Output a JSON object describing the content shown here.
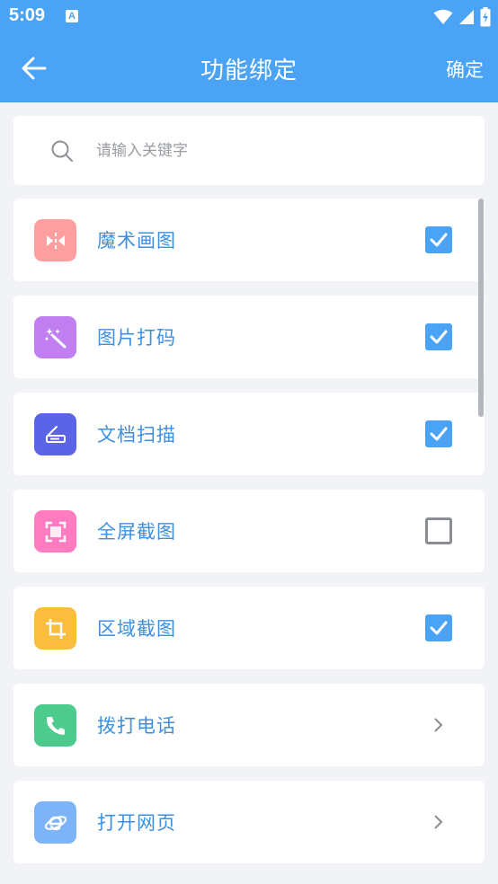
{
  "status_bar": {
    "time": "5:09",
    "notification_badge": "A"
  },
  "app_bar": {
    "title": "功能绑定",
    "confirm_label": "确定",
    "color": "#4aa3f4"
  },
  "search": {
    "placeholder": "请输入关键字"
  },
  "items": [
    {
      "label": "魔术画图",
      "icon": "magic-draw-icon",
      "icon_color": "#ff9f9f",
      "control": "checkbox",
      "checked": true
    },
    {
      "label": "图片打码",
      "icon": "magic-wand-icon",
      "icon_color": "#c07ef0",
      "control": "checkbox",
      "checked": true
    },
    {
      "label": "文档扫描",
      "icon": "scanner-icon",
      "icon_color": "#5b63e6",
      "control": "checkbox",
      "checked": true
    },
    {
      "label": "全屏截图",
      "icon": "fullscreen-capture-icon",
      "icon_color": "#ff7cc0",
      "control": "checkbox",
      "checked": false
    },
    {
      "label": "区域截图",
      "icon": "crop-icon",
      "icon_color": "#fbbd3d",
      "control": "checkbox",
      "checked": true
    },
    {
      "label": "拨打电话",
      "icon": "phone-icon",
      "icon_color": "#4ccb8d",
      "control": "chevron"
    },
    {
      "label": "打开网页",
      "icon": "browser-icon",
      "icon_color": "#7db4f8",
      "control": "chevron"
    }
  ]
}
